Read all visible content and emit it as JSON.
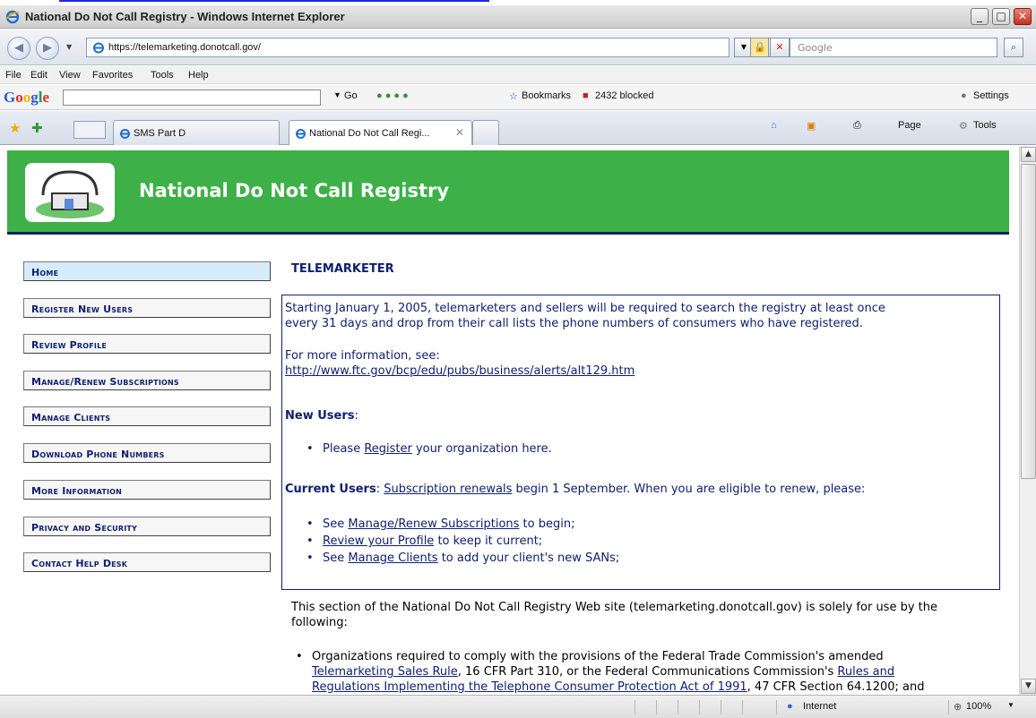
{
  "window": {
    "title": "National Do Not Call Registry - Windows Internet Explorer",
    "min": "_",
    "max": "□",
    "close": "✕"
  },
  "address": {
    "url": "https://telemarketing.donotcall.gov/",
    "search_placeholder": "Google"
  },
  "menu": [
    "File",
    "Edit",
    "View",
    "Favorites",
    "Tools",
    "Help"
  ],
  "google_toolbar": {
    "logo": "Google",
    "go": "Go",
    "bookmarks": "Bookmarks",
    "blocked": "2432 blocked",
    "settings": "Settings"
  },
  "tabs": [
    {
      "label": "SMS Part D"
    },
    {
      "label": "National Do Not Call Regi..."
    }
  ],
  "cmdbar": {
    "page": "Page",
    "tools": "Tools"
  },
  "site": {
    "title": "National Do Not Call Registry",
    "nav": [
      "Home",
      "Register New Users",
      "Review Profile",
      "Manage/Renew Subscriptions",
      "Manage Clients",
      "Download Phone Numbers",
      "More Information",
      "Privacy and Security",
      "Contact Help Desk"
    ],
    "heading": "TELEMARKETER",
    "intro1": "Starting January 1, 2005, telemarketers and sellers will be required to search the registry at least once",
    "intro2": "every 31 days and drop from their call lists the phone numbers of consumers who have registered.",
    "more_info": "For more information, see:",
    "more_info_link": "http://www.ftc.gov/bcp/edu/pubs/business/alerts/alt129.htm",
    "new_users_label": "New Users",
    "new_users_colon": ":",
    "new_users_b1_pre": "Please ",
    "new_users_b1_link": "Register",
    "new_users_b1_post": " your organization here.",
    "current_users_label": "Current Users",
    "current_users_colon": ": ",
    "current_users_link": "Subscription renewals",
    "current_users_post": " begin 1 September. When you are eligible to renew, please:",
    "cu_b1_pre": "See ",
    "cu_b1_link": "Manage/Renew Subscriptions",
    "cu_b1_post": " to begin;",
    "cu_b2_link": "Review your Profile",
    "cu_b2_post": " to keep it current;",
    "cu_b3_pre": "See ",
    "cu_b3_link": "Manage Clients",
    "cu_b3_post": " to add your client's new SANs;",
    "section1": "This section of the National Do Not Call Registry Web site (telemarketing.donotcall.gov) is solely for use by the",
    "section2": "following:",
    "org1": "Organizations required to comply with the provisions of the Federal Trade Commission's amended",
    "org2_link1": "Telemarketing Sales Rule",
    "org2_mid": ", 16 CFR Part 310, or the Federal Communications Commission's ",
    "org2_link2": "Rules and",
    "org3_link": "Regulations Implementing the Telephone Consumer Protection Act of 1991",
    "org3_post": ", 47 CFR Section 64.1200; and"
  },
  "status": {
    "zone": "Internet",
    "zoom": "100%"
  }
}
